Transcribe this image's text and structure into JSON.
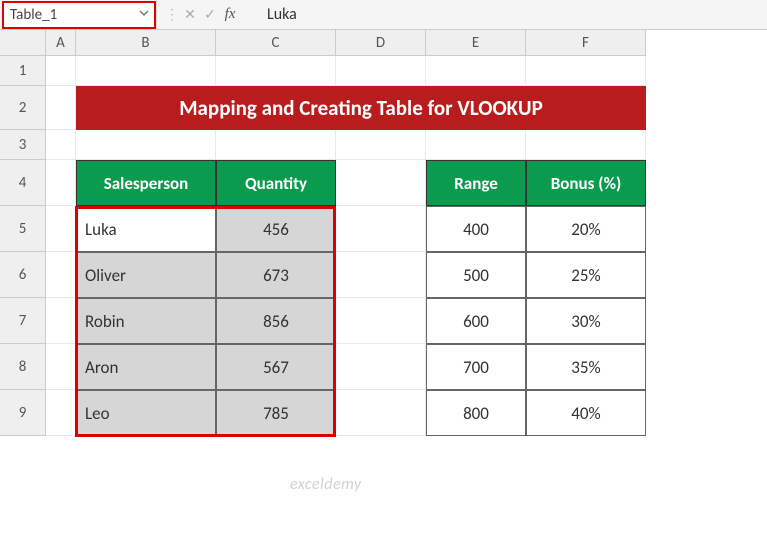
{
  "name_box": "Table_1",
  "formula_value": "Luka",
  "columns": [
    "A",
    "B",
    "C",
    "D",
    "E",
    "F"
  ],
  "rows": [
    "1",
    "2",
    "3",
    "4",
    "5",
    "6",
    "7",
    "8",
    "9"
  ],
  "title": "Mapping and Creating Table for VLOOKUP",
  "table1": {
    "headers": [
      "Salesperson",
      "Quantity"
    ],
    "rows": [
      {
        "salesperson": "Luka",
        "quantity": "456"
      },
      {
        "salesperson": "Oliver",
        "quantity": "673"
      },
      {
        "salesperson": "Robin",
        "quantity": "856"
      },
      {
        "salesperson": "Aron",
        "quantity": "567"
      },
      {
        "salesperson": "Leo",
        "quantity": "785"
      }
    ]
  },
  "table2": {
    "headers": [
      "Range",
      "Bonus (%)"
    ],
    "rows": [
      {
        "range": "400",
        "bonus": "20%"
      },
      {
        "range": "500",
        "bonus": "25%"
      },
      {
        "range": "600",
        "bonus": "30%"
      },
      {
        "range": "700",
        "bonus": "35%"
      },
      {
        "range": "800",
        "bonus": "40%"
      }
    ]
  },
  "watermark": "exceldemy"
}
